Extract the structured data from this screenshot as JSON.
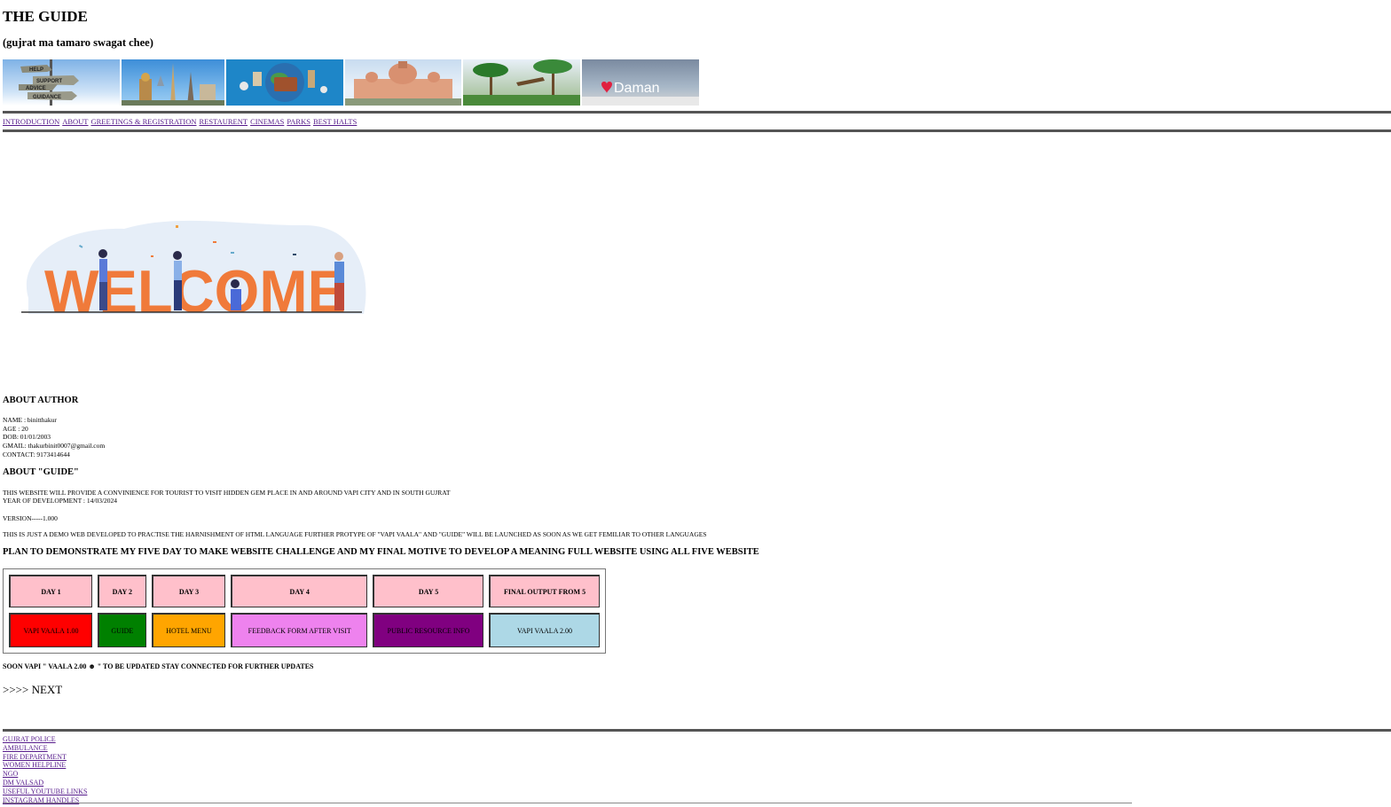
{
  "header": {
    "title": "THE GUIDE",
    "subtitle": "(gujrat ma tamaro swagat chee)"
  },
  "banner": {
    "images": [
      {
        "name": "signpost-image",
        "labels": [
          "HELP",
          "SUPPORT",
          "ADVICE",
          "GUIDANCE"
        ]
      },
      {
        "name": "world-landmarks-image"
      },
      {
        "name": "travel-globe-image"
      },
      {
        "name": "palace-image"
      },
      {
        "name": "park-image"
      },
      {
        "name": "daman-image",
        "text": "Daman"
      }
    ]
  },
  "nav": {
    "links": [
      "INTRODUCTION",
      "ABOUT",
      "GREETINGS & REGISTRATION",
      "RESTAURENT",
      "CINEMAS",
      "PARKS",
      "BEST HALTS"
    ]
  },
  "welcome": {
    "text": "WELCOME"
  },
  "author": {
    "heading": "ABOUT AUTHOR",
    "lines": [
      "NAME : binitthakur",
      "AGE : 20",
      "DOB: 01/01/2003",
      "GMAIL: thakurbinit0007@gmail.com",
      "CONTACT: 9173414644"
    ]
  },
  "about_guide": {
    "heading": "ABOUT \"GUIDE\"",
    "description": "THIS WEBSITE WILL PROVIDE A CONVINIENCE FOR TOURIST TO VISIT HIDDEN GEM PLACE IN AND AROUND VAPI CITY AND IN SOUTH GUJRAT",
    "year": "YEAR OF DEVELOPMENT : 14/03/2024",
    "version": "VERSION-----1.000",
    "note": "THIS IS JUST A DEMO WEB DEVELOPED TO PRACTISE THE HARNISHMENT OF HTML LANGUAGE FURTHER PROTYPE OF \"VAPI VAALA\" AND \"GUIDE\" WILL BE LAUNCHED AS SOON AS WE GET FEMILIAR TO OTHER LANGUAGES"
  },
  "plan": {
    "heading": "PLAN TO DEMONSTRATE MY FIVE DAY TO MAKE WEBSITE CHALLENGE AND MY FINAL MOTIVE TO DEVELOP A MEANING FULL WEBSITE USING ALL FIVE WEBSITE",
    "columns": [
      {
        "day": "DAY 1",
        "project": "VAPI VAALA 1.00",
        "color": "#ff0000"
      },
      {
        "day": "DAY 2",
        "project": "GUIDE",
        "color": "#008000"
      },
      {
        "day": "DAY 3",
        "project": "HOTEL MENU",
        "color": "#ffa500"
      },
      {
        "day": "DAY 4",
        "project": "FEEDBACK FORM AFTER VISIT",
        "color": "#ee82ee"
      },
      {
        "day": "DAY 5",
        "project": "PUBLIC RESOURCE INFO",
        "color": "#800080"
      },
      {
        "day": "FINAL OUTPUT FROM 5",
        "project": "VAPI VAALA 2.00",
        "color": "#add8e6"
      }
    ]
  },
  "soon": "SOON VAPI \" VAALA 2.00 ☻ \" TO BE UPDATED STAY CONNECTED FOR FURTHER UPDATES",
  "next": ">>>> NEXT",
  "footer": {
    "links": [
      "GUJRAT POLICE",
      "AMBULANCE",
      "FIRE DEPARTMENT",
      "WOMEN HELPLINE",
      "NGO",
      "DM VALSAD",
      "USEFUL YOUTUBE LINKS",
      "INSTAGRAM HANDLES"
    ]
  }
}
